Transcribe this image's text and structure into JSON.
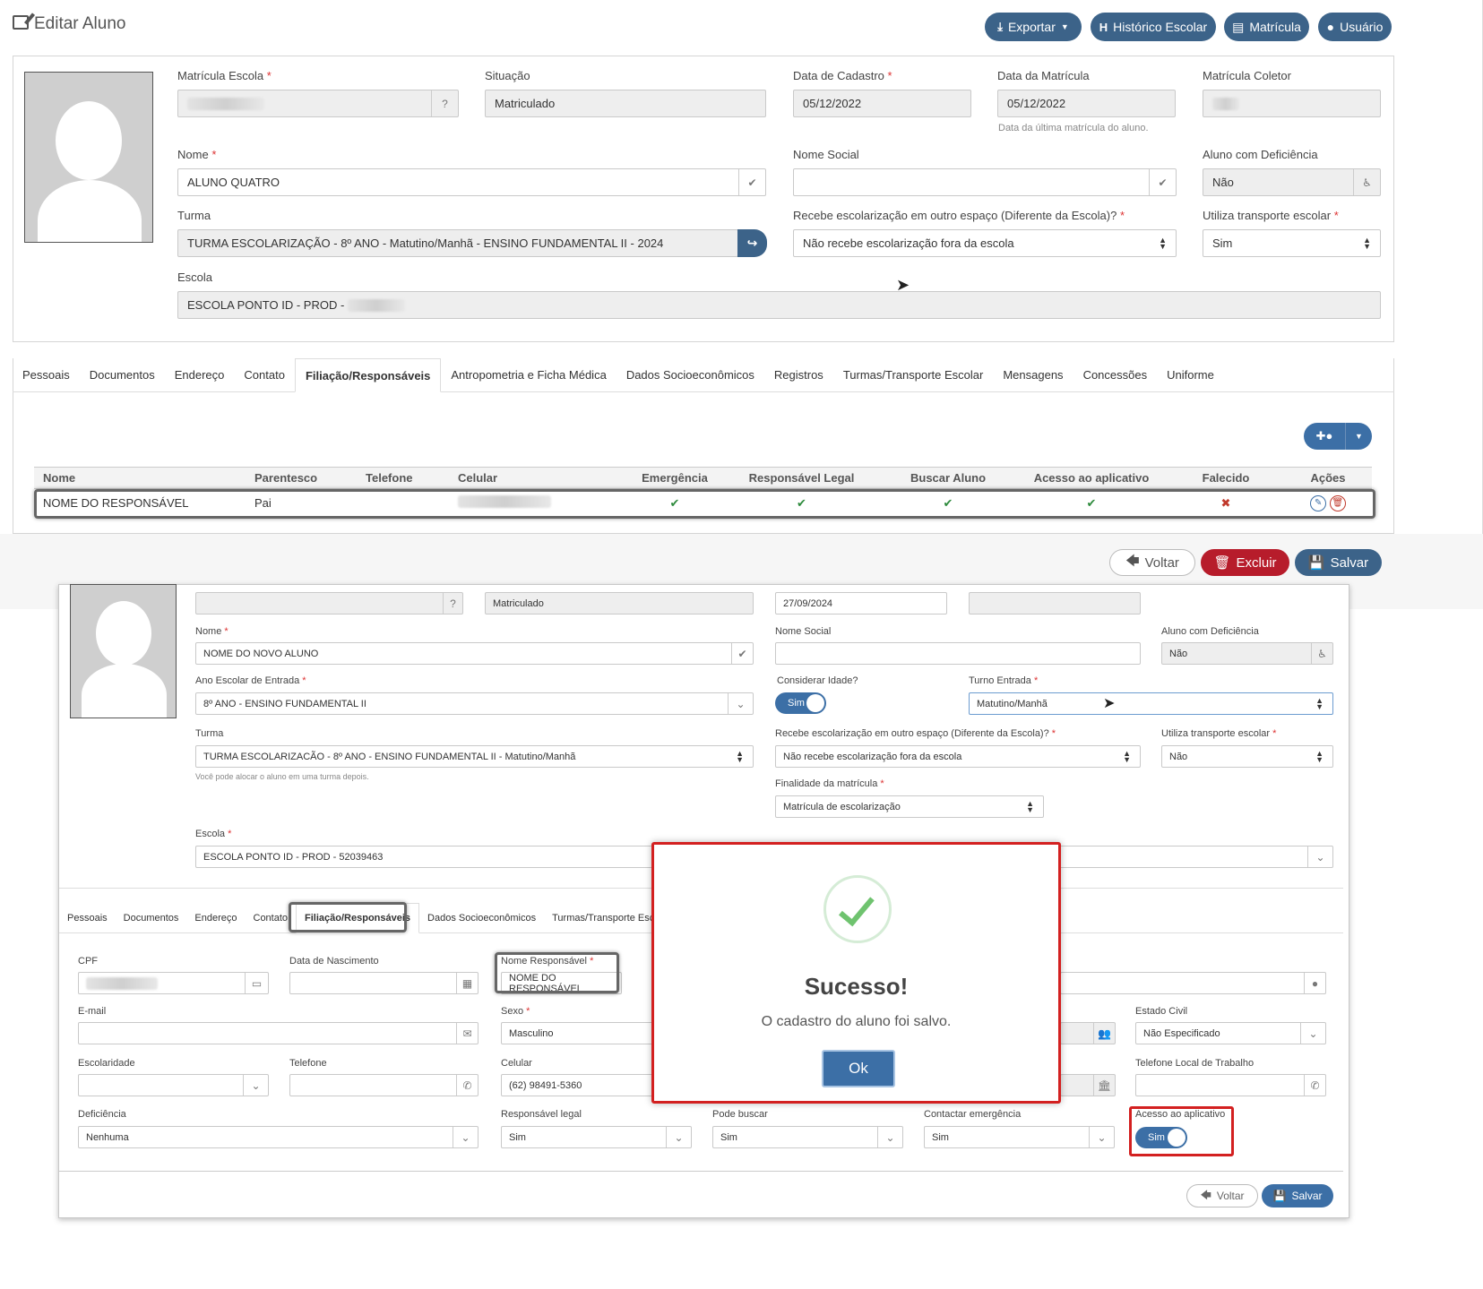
{
  "top": {
    "title": "Editar Aluno",
    "actions": {
      "exportar": "Exportar",
      "historico": "Histórico Escolar",
      "matricula": "Matrícula",
      "usuario": "Usuário"
    },
    "form": {
      "matricula_escola_label": "Matrícula Escola",
      "situacao_label": "Situação",
      "situacao_value": "Matriculado",
      "data_cadastro_label": "Data de Cadastro",
      "data_cadastro_value": "05/12/2022",
      "data_matricula_label": "Data da Matrícula",
      "data_matricula_value": "05/12/2022",
      "data_matricula_hint": "Data da última matrícula do aluno.",
      "matricula_coletor_label": "Matrícula Coletor",
      "nome_label": "Nome",
      "nome_value": "ALUNO QUATRO",
      "nome_social_label": "Nome Social",
      "deficiencia_label": "Aluno com Deficiência",
      "deficiencia_value": "Não",
      "turma_label": "Turma",
      "turma_value": "TURMA ESCOLARIZAÇÃO - 8º ANO - Matutino/Manhã - ENSINO FUNDAMENTAL II - 2024",
      "escolarizacao_label": "Recebe escolarização em outro espaço (Diferente da Escola)?",
      "escolarizacao_value": "Não recebe escolarização fora da escola",
      "transporte_label": "Utiliza transporte escolar",
      "transporte_value": "Sim",
      "escola_label": "Escola",
      "escola_value": "ESCOLA PONTO ID - PROD -"
    },
    "tabs": [
      "Pessoais",
      "Documentos",
      "Endereço",
      "Contato",
      "Filiação/Responsáveis",
      "Antropometria e Ficha Médica",
      "Dados Socioeconômicos",
      "Registros",
      "Turmas/Transporte Escolar",
      "Mensagens",
      "Concessões",
      "Uniforme"
    ],
    "table": {
      "headers": [
        "Nome",
        "Parentesco",
        "Telefone",
        "Celular",
        "Emergência",
        "Responsável Legal",
        "Buscar Aluno",
        "Acesso ao aplicativo",
        "Falecido",
        "Ações"
      ],
      "row": {
        "nome": "NOME DO RESPONSÁVEL",
        "parentesco": "Pai"
      }
    },
    "footer": {
      "voltar": "Voltar",
      "excluir": "Excluir",
      "salvar": "Salvar"
    }
  },
  "bottom": {
    "situacao_value": "Matriculado",
    "data_value": "27/09/2024",
    "nome_label": "Nome",
    "nome_value": "NOME DO NOVO ALUNO",
    "nome_social_label": "Nome Social",
    "deficiencia_label": "Aluno com Deficiência",
    "deficiencia_value": "Não",
    "ano_label": "Ano Escolar de Entrada",
    "ano_value": "8º ANO - ENSINO FUNDAMENTAL II",
    "idade_label": "Considerar Idade?",
    "idade_value": "Sim",
    "turno_label": "Turno Entrada",
    "turno_value": "Matutino/Manhã",
    "turma_label": "Turma",
    "turma_value": "TURMA ESCOLARIZACÃO - 8º ANO - ENSINO FUNDAMENTAL II - Matutino/Manhã",
    "turma_hint": "Você pode alocar o aluno em uma turma depois.",
    "escolarizacao_label": "Recebe escolarização em outro espaço (Diferente da Escola)?",
    "escolarizacao_value": "Não recebe escolarização fora da escola",
    "transporte_label": "Utiliza transporte escolar",
    "transporte_value": "Não",
    "finalidade_label": "Finalidade da matrícula",
    "finalidade_value": "Matrícula de escolarização",
    "escola_label": "Escola",
    "escola_value": "ESCOLA PONTO ID - PROD - 52039463",
    "tabs": [
      "Pessoais",
      "Documentos",
      "Endereço",
      "Contato",
      "Filiação/Responsáveis",
      "Dados Socioeconômicos",
      "Turmas/Transporte Escolar"
    ],
    "resp": {
      "cpf_label": "CPF",
      "nasc_label": "Data de Nascimento",
      "nome_resp_label": "Nome Responsável",
      "nome_resp_value": "NOME DO RESPONSÁVEL",
      "email_label": "E-mail",
      "sexo_label": "Sexo",
      "sexo_value": "Masculino",
      "estado_civil_label": "Estado Civil",
      "estado_civil_value": "Não Especificado",
      "escolaridade_label": "Escolaridade",
      "telefone_label": "Telefone",
      "celular_label": "Celular",
      "celular_value": "(62) 98491-5360",
      "tel_trabalho_label": "Telefone Local de Trabalho",
      "deficiencia_label": "Deficiência",
      "deficiencia_value": "Nenhuma",
      "resp_legal_label": "Responsável legal",
      "resp_legal_value": "Sim",
      "pode_buscar_label": "Pode buscar",
      "pode_buscar_value": "Sim",
      "emergencia_label": "Contactar emergência",
      "emergencia_value": "Sim",
      "acesso_label": "Acesso ao aplicativo",
      "acesso_value": "Sim"
    },
    "footer": {
      "voltar": "Voltar",
      "salvar": "Salvar"
    }
  },
  "modal": {
    "title": "Sucesso!",
    "message": "O cadastro do aluno foi salvo.",
    "ok": "Ok"
  },
  "colors": {
    "primary": "#3c6389",
    "danger": "#b71c2b",
    "success": "#2e8b3d",
    "highlight": "#d32020"
  }
}
